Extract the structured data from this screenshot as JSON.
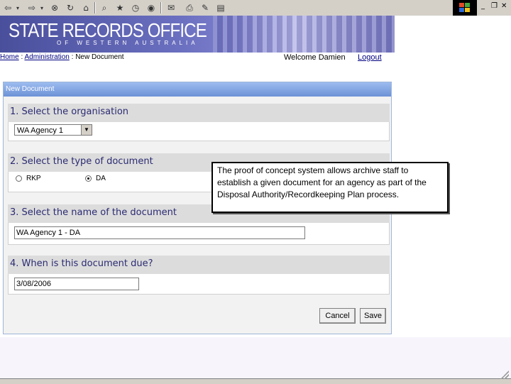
{
  "toolbar": {
    "icons": [
      "back-icon",
      "forward-icon",
      "stop-icon",
      "refresh-icon",
      "home-icon",
      "search-icon",
      "favorites-icon",
      "history-icon",
      "media-icon",
      "mail-icon",
      "print-icon",
      "edit-icon",
      "discuss-icon"
    ]
  },
  "banner": {
    "title": "STATE RECORDS OFFICE",
    "subtitle": "OF WESTERN AUSTRALIA"
  },
  "breadcrumb": {
    "home": "Home",
    "sep1": " : ",
    "admin": "Administration",
    "sep2": " : ",
    "current": "New Document"
  },
  "user": {
    "welcome": "Welcome Damien",
    "logout": "Logout"
  },
  "panel": {
    "title": "New Document",
    "sections": [
      {
        "heading": "1. Select the organisation"
      },
      {
        "heading": "2. Select the type of document"
      },
      {
        "heading": "3. Select the name of the document"
      },
      {
        "heading": "4. When is this document due?"
      }
    ],
    "organisation_value": "WA Agency 1",
    "doc_types": [
      {
        "label": "RKP",
        "selected": false
      },
      {
        "label": "DA",
        "selected": true
      }
    ],
    "document_name_value": "WA Agency 1 - DA",
    "due_date_value": "3/08/2006",
    "cancel_label": "Cancel",
    "save_label": "Save"
  },
  "callout": {
    "text": "The proof of concept system allows archive staff to establish a given document for an agency as part of the Disposal Authority/Recordkeeping Plan process."
  },
  "colors": {
    "banner": "#5a5fb0",
    "panel_header": "#7b9ddc",
    "section_heading_text": "#2b2b73"
  }
}
